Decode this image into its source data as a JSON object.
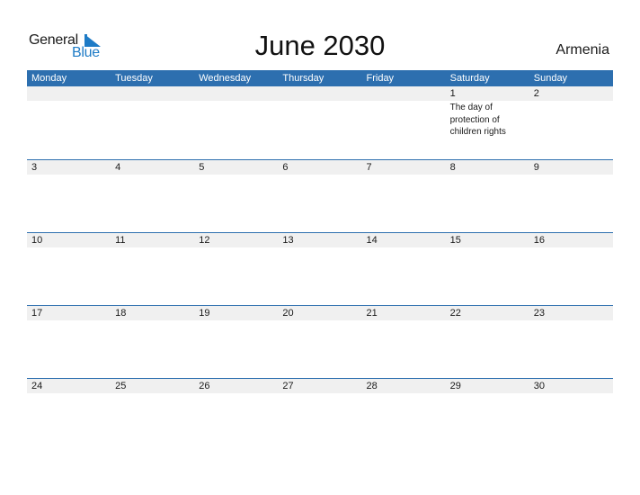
{
  "logo": {
    "word1": "General",
    "word2": "Blue",
    "accent_color": "#1e7bc6"
  },
  "title": "June 2030",
  "country": "Armenia",
  "header_color": "#2d6faf",
  "weekdays": [
    "Monday",
    "Tuesday",
    "Wednesday",
    "Thursday",
    "Friday",
    "Saturday",
    "Sunday"
  ],
  "weeks": [
    [
      {
        "day": "",
        "note": ""
      },
      {
        "day": "",
        "note": ""
      },
      {
        "day": "",
        "note": ""
      },
      {
        "day": "",
        "note": ""
      },
      {
        "day": "",
        "note": ""
      },
      {
        "day": "1",
        "note": "The day of protection of children rights"
      },
      {
        "day": "2",
        "note": ""
      }
    ],
    [
      {
        "day": "3",
        "note": ""
      },
      {
        "day": "4",
        "note": ""
      },
      {
        "day": "5",
        "note": ""
      },
      {
        "day": "6",
        "note": ""
      },
      {
        "day": "7",
        "note": ""
      },
      {
        "day": "8",
        "note": ""
      },
      {
        "day": "9",
        "note": ""
      }
    ],
    [
      {
        "day": "10",
        "note": ""
      },
      {
        "day": "11",
        "note": ""
      },
      {
        "day": "12",
        "note": ""
      },
      {
        "day": "13",
        "note": ""
      },
      {
        "day": "14",
        "note": ""
      },
      {
        "day": "15",
        "note": ""
      },
      {
        "day": "16",
        "note": ""
      }
    ],
    [
      {
        "day": "17",
        "note": ""
      },
      {
        "day": "18",
        "note": ""
      },
      {
        "day": "19",
        "note": ""
      },
      {
        "day": "20",
        "note": ""
      },
      {
        "day": "21",
        "note": ""
      },
      {
        "day": "22",
        "note": ""
      },
      {
        "day": "23",
        "note": ""
      }
    ],
    [
      {
        "day": "24",
        "note": ""
      },
      {
        "day": "25",
        "note": ""
      },
      {
        "day": "26",
        "note": ""
      },
      {
        "day": "27",
        "note": ""
      },
      {
        "day": "28",
        "note": ""
      },
      {
        "day": "29",
        "note": ""
      },
      {
        "day": "30",
        "note": ""
      }
    ]
  ]
}
